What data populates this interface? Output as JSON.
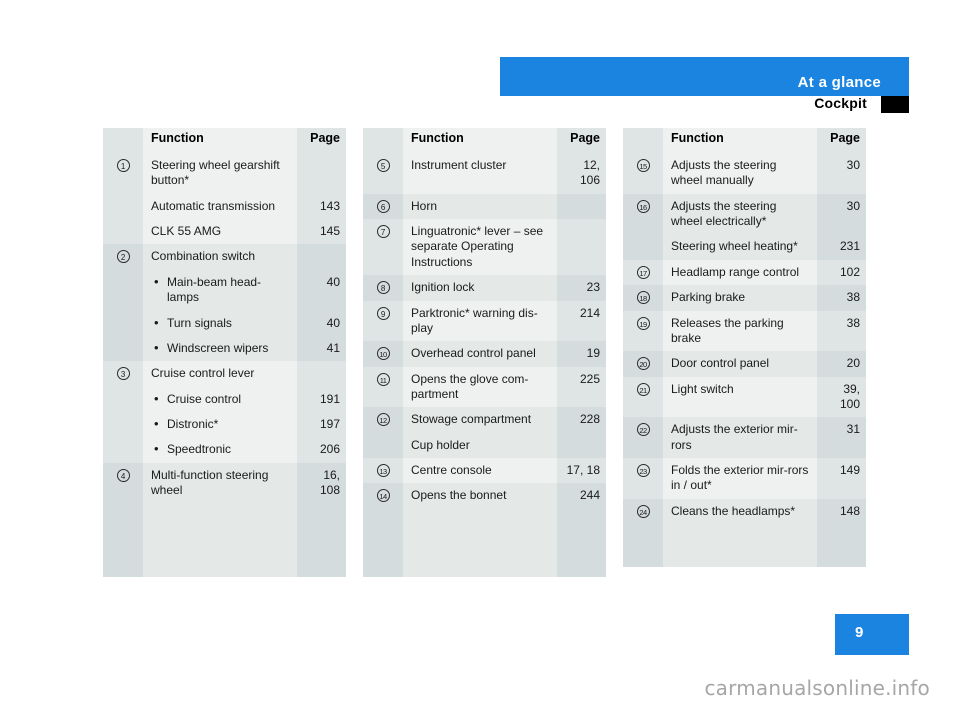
{
  "header": {
    "band_title": "At a glance",
    "sub_title": "Cockpit",
    "band_color": "#1b84e0",
    "marker_color": "#000000"
  },
  "footer": {
    "page_number": "9",
    "watermark": "carmanualsonline.info"
  },
  "table_headers": {
    "function": "Function",
    "page": "Page"
  },
  "columns": [
    {
      "id": "column-1",
      "rows": [
        {
          "num": "1",
          "lines": [
            {
              "text": "Steering wheel gearshift button*",
              "page": "",
              "bullet": false
            }
          ],
          "extra": [
            {
              "text": "Automatic transmission",
              "page": "143"
            },
            {
              "text": "CLK 55 AMG",
              "page": "145"
            }
          ],
          "alt": false
        },
        {
          "num": "2",
          "lines": [
            {
              "text": "Combination switch",
              "page": "",
              "bullet": false
            },
            {
              "text": "Main-beam head-lamps",
              "page": "40",
              "bullet": true
            },
            {
              "text": "Turn signals",
              "page": "40",
              "bullet": true
            },
            {
              "text": "Windscreen wipers",
              "page": "41",
              "bullet": true
            }
          ],
          "extra": [],
          "alt": true
        },
        {
          "num": "3",
          "lines": [
            {
              "text": "Cruise control lever",
              "page": "",
              "bullet": false
            },
            {
              "text": "Cruise control",
              "page": "191",
              "bullet": true
            },
            {
              "text": "Distronic*",
              "page": "197",
              "bullet": true
            },
            {
              "text": "Speedtronic",
              "page": "206",
              "bullet": true
            }
          ],
          "extra": [],
          "alt": false
        },
        {
          "num": "4",
          "lines": [
            {
              "text": "Multi-function steering wheel",
              "page": "16,\n108",
              "bullet": false
            }
          ],
          "extra": [],
          "alt": true
        }
      ]
    },
    {
      "id": "column-2",
      "rows": [
        {
          "num": "5",
          "lines": [
            {
              "text": "Instrument cluster",
              "page": "12,\n106",
              "bullet": false
            }
          ],
          "extra": [],
          "alt": false
        },
        {
          "num": "6",
          "lines": [
            {
              "text": "Horn",
              "page": "",
              "bullet": false
            }
          ],
          "extra": [],
          "alt": true
        },
        {
          "num": "7",
          "lines": [
            {
              "text": "Linguatronic* lever – see separate Operating Instructions",
              "page": "",
              "bullet": false
            }
          ],
          "extra": [],
          "alt": false
        },
        {
          "num": "8",
          "lines": [
            {
              "text": "Ignition lock",
              "page": "23",
              "bullet": false
            }
          ],
          "extra": [],
          "alt": true
        },
        {
          "num": "9",
          "lines": [
            {
              "text": "Parktronic* warning dis-play",
              "page": "214",
              "bullet": false
            }
          ],
          "extra": [],
          "alt": false
        },
        {
          "num": "10",
          "lines": [
            {
              "text": "Overhead control panel",
              "page": "19",
              "bullet": false
            }
          ],
          "extra": [],
          "alt": true
        },
        {
          "num": "11",
          "lines": [
            {
              "text": "Opens the glove com-partment",
              "page": "225",
              "bullet": false
            }
          ],
          "extra": [],
          "alt": false
        },
        {
          "num": "12",
          "lines": [
            {
              "text": "Stowage compartment",
              "page": "228",
              "bullet": false
            }
          ],
          "extra": [
            {
              "text": "Cup holder",
              "page": ""
            }
          ],
          "alt": true
        },
        {
          "num": "13",
          "lines": [
            {
              "text": "Centre console",
              "page": "17, 18",
              "bullet": false
            }
          ],
          "extra": [],
          "alt": false
        },
        {
          "num": "14",
          "lines": [
            {
              "text": "Opens the bonnet",
              "page": "244",
              "bullet": false
            }
          ],
          "extra": [],
          "alt": true
        }
      ]
    },
    {
      "id": "column-3",
      "rows": [
        {
          "num": "15",
          "lines": [
            {
              "text": "Adjusts the steering wheel manually",
              "page": "30",
              "bullet": false
            }
          ],
          "extra": [],
          "alt": false
        },
        {
          "num": "16",
          "lines": [
            {
              "text": "Adjusts the steering wheel electrically*",
              "page": "30",
              "bullet": false
            }
          ],
          "extra": [
            {
              "text": "Steering wheel heating*",
              "page": "231"
            }
          ],
          "alt": true
        },
        {
          "num": "17",
          "lines": [
            {
              "text": "Headlamp range control",
              "page": "102",
              "bullet": false
            }
          ],
          "extra": [],
          "alt": false
        },
        {
          "num": "18",
          "lines": [
            {
              "text": "Parking brake",
              "page": "38",
              "bullet": false
            }
          ],
          "extra": [],
          "alt": true
        },
        {
          "num": "19",
          "lines": [
            {
              "text": "Releases the parking brake",
              "page": "38",
              "bullet": false
            }
          ],
          "extra": [],
          "alt": false
        },
        {
          "num": "20",
          "lines": [
            {
              "text": "Door control panel",
              "page": "20",
              "bullet": false
            }
          ],
          "extra": [],
          "alt": true
        },
        {
          "num": "21",
          "lines": [
            {
              "text": "Light switch",
              "page": "39,\n100",
              "bullet": false
            }
          ],
          "extra": [],
          "alt": false
        },
        {
          "num": "22",
          "lines": [
            {
              "text": "Adjusts the exterior mir-rors",
              "page": "31",
              "bullet": false
            }
          ],
          "extra": [],
          "alt": true
        },
        {
          "num": "23",
          "lines": [
            {
              "text": "Folds the exterior mir-rors in / out*",
              "page": "149",
              "bullet": false
            }
          ],
          "extra": [],
          "alt": false
        },
        {
          "num": "24",
          "lines": [
            {
              "text": "Cleans the headlamps*",
              "page": "148",
              "bullet": false
            }
          ],
          "extra": [],
          "alt": true
        }
      ]
    }
  ]
}
